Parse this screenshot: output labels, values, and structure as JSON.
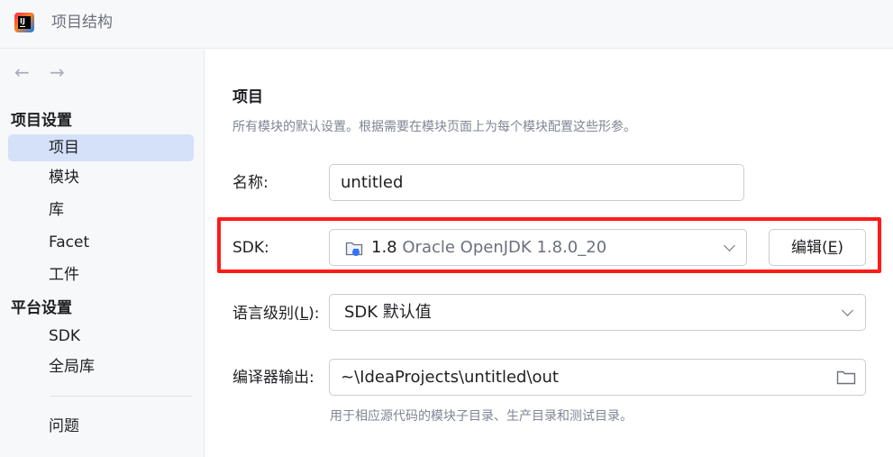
{
  "window": {
    "title": "项目结构",
    "logo_icon": "intellij-idea-logo",
    "logo_text": "IJ"
  },
  "sidebar": {
    "nav": {
      "back_glyph": "←",
      "forward_glyph": "→"
    },
    "sections": [
      {
        "title": "项目设置"
      },
      {
        "title": "平台设置"
      }
    ],
    "items": [
      {
        "label": "项目"
      },
      {
        "label": "模块"
      },
      {
        "label": "库"
      },
      {
        "label": "Facet"
      },
      {
        "label": "工件"
      },
      {
        "label": "SDK"
      },
      {
        "label": "全局库"
      },
      {
        "label": "问题"
      }
    ],
    "selected_item": "项目"
  },
  "main": {
    "title": "项目",
    "description": "所有模块的默认设置。根据需要在模块页面上为每个模块配置这些形参。",
    "name_field": {
      "label": "名称:",
      "value": "untitled"
    },
    "sdk_field": {
      "label": "SDK:",
      "version": "1.8",
      "name": "Oracle OpenJDK 1.8.0_20",
      "icon": "jdk-folder-icon",
      "edit_label_prefix": "编辑(",
      "edit_mnemonic": "E",
      "edit_label_suffix": ")"
    },
    "language_level": {
      "label_prefix": "语言级别(",
      "mnemonic": "L",
      "label_suffix": "):",
      "value": "SDK 默认值"
    },
    "compiler_output": {
      "label": "编译器输出:",
      "value": "~\\IdeaProjects\\untitled\\out",
      "hint": "用于相应源代码的模块子目录、生产目录和测试目录。"
    }
  },
  "colors": {
    "highlight_border": "#ff1a1a",
    "selection_bg": "#d5e1f9",
    "sidebar_bg": "#f7f8fa"
  }
}
